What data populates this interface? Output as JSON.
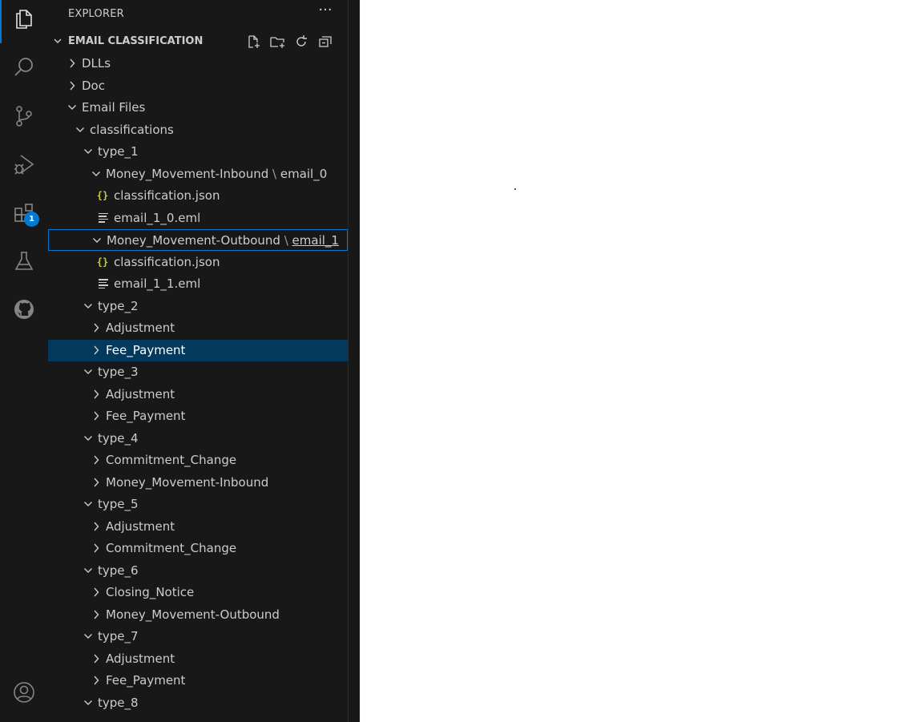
{
  "sidebar": {
    "title": "EXPLORER",
    "more_actions": "···",
    "section_title": "EMAIL CLASSIFICATION",
    "section_actions": [
      "new-file",
      "new-folder",
      "refresh",
      "collapse-all"
    ]
  },
  "activity_bar": {
    "items": [
      "explorer",
      "search",
      "source-control",
      "run-and-debug",
      "extensions",
      "testing",
      "github"
    ],
    "extensions_badge": "1",
    "bottom": [
      "accounts"
    ]
  },
  "tree": [
    {
      "label": "DLLs",
      "kind": "folder",
      "expanded": false,
      "depth": 0
    },
    {
      "label": "Doc",
      "kind": "folder",
      "expanded": false,
      "depth": 0
    },
    {
      "label": "Email Files",
      "kind": "folder",
      "expanded": true,
      "depth": 0
    },
    {
      "label": "classifications",
      "kind": "folder",
      "expanded": true,
      "depth": 1
    },
    {
      "label": "type_1",
      "kind": "folder",
      "expanded": true,
      "depth": 2
    },
    {
      "label": "Money_Movement-Inbound",
      "sep": "\\",
      "suffix": "email_0",
      "kind": "folder",
      "expanded": true,
      "depth": 3
    },
    {
      "label": "classification.json",
      "kind": "json",
      "depth": 4
    },
    {
      "label": "email_1_0.eml",
      "kind": "text",
      "depth": 4
    },
    {
      "label": "Money_Movement-Outbound",
      "sep": "\\",
      "suffix": "email_1",
      "kind": "folder",
      "expanded": true,
      "depth": 3,
      "focus": true
    },
    {
      "label": "classification.json",
      "kind": "json",
      "depth": 4
    },
    {
      "label": "email_1_1.eml",
      "kind": "text",
      "depth": 4
    },
    {
      "label": "type_2",
      "kind": "folder",
      "expanded": true,
      "depth": 2
    },
    {
      "label": "Adjustment",
      "kind": "folder",
      "expanded": false,
      "depth": 3
    },
    {
      "label": "Fee_Payment",
      "kind": "folder",
      "expanded": false,
      "depth": 3,
      "selected": true
    },
    {
      "label": "type_3",
      "kind": "folder",
      "expanded": true,
      "depth": 2
    },
    {
      "label": "Adjustment",
      "kind": "folder",
      "expanded": false,
      "depth": 3
    },
    {
      "label": "Fee_Payment",
      "kind": "folder",
      "expanded": false,
      "depth": 3
    },
    {
      "label": "type_4",
      "kind": "folder",
      "expanded": true,
      "depth": 2
    },
    {
      "label": "Commitment_Change",
      "kind": "folder",
      "expanded": false,
      "depth": 3
    },
    {
      "label": "Money_Movement-Inbound",
      "kind": "folder",
      "expanded": false,
      "depth": 3
    },
    {
      "label": "type_5",
      "kind": "folder",
      "expanded": true,
      "depth": 2
    },
    {
      "label": "Adjustment",
      "kind": "folder",
      "expanded": false,
      "depth": 3
    },
    {
      "label": "Commitment_Change",
      "kind": "folder",
      "expanded": false,
      "depth": 3
    },
    {
      "label": "type_6",
      "kind": "folder",
      "expanded": true,
      "depth": 2
    },
    {
      "label": "Closing_Notice",
      "kind": "folder",
      "expanded": false,
      "depth": 3
    },
    {
      "label": "Money_Movement-Outbound",
      "kind": "folder",
      "expanded": false,
      "depth": 3
    },
    {
      "label": "type_7",
      "kind": "folder",
      "expanded": true,
      "depth": 2
    },
    {
      "label": "Adjustment",
      "kind": "folder",
      "expanded": false,
      "depth": 3
    },
    {
      "label": "Fee_Payment",
      "kind": "folder",
      "expanded": false,
      "depth": 3
    },
    {
      "label": "type_8",
      "kind": "folder",
      "expanded": true,
      "depth": 2
    }
  ],
  "colors": {
    "accent": "#0078d4",
    "selected_bg": "#04395e",
    "json_icon": "#cbcb41"
  }
}
